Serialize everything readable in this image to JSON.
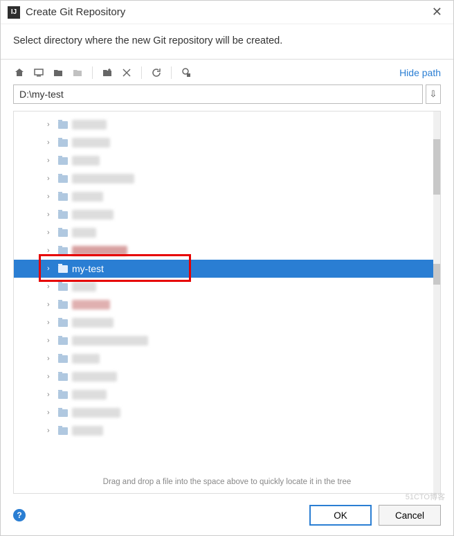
{
  "window": {
    "title": "Create Git Repository",
    "subtitle": "Select directory where the new Git repository will be created."
  },
  "toolbar": {
    "hide_path_label": "Hide path"
  },
  "path": {
    "value": "D:\\my-test"
  },
  "tree": {
    "selected_label": "my-test",
    "hint": "Drag and drop a file into the space above to quickly locate it in the tree"
  },
  "footer": {
    "ok_label": "OK",
    "cancel_label": "Cancel"
  },
  "watermark": "51CTO博客"
}
